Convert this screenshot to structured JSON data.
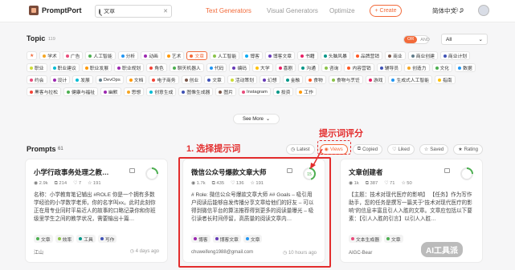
{
  "header": {
    "logo_text": "PromptPort",
    "search_value": "文章",
    "search_clear": "✕",
    "nav": [
      "Text Generators",
      "Visual Generators",
      "Optimize"
    ],
    "create_label": "+ Create",
    "language": "简体中文 ⌄",
    "credits": "9"
  },
  "topic": {
    "title": "Topic",
    "count": "119",
    "toggle": [
      "OR",
      "AND"
    ],
    "select_value": "All",
    "see_more": "See More",
    "chips": [
      {
        "label": "",
        "color": "#f26a3a",
        "star": true
      },
      {
        "label": "学术",
        "color": "#f5a623"
      },
      {
        "label": "广告",
        "color": "#e94b7a"
      },
      {
        "label": "人工智能",
        "color": "#4caf50"
      },
      {
        "label": "分析",
        "color": "#2196f3"
      },
      {
        "label": "动画",
        "color": "#9c27b0"
      },
      {
        "label": "艺术",
        "color": "#ff9800"
      },
      {
        "label": "文章",
        "color": "#f26a3a",
        "active": true
      },
      {
        "label": "人工智能",
        "color": "#8bc34a"
      },
      {
        "label": "博客",
        "color": "#03a9f4"
      },
      {
        "label": "博客文章",
        "color": "#673ab7"
      },
      {
        "label": "书籍",
        "color": "#e91e63"
      },
      {
        "label": "头脑风暴",
        "color": "#009688"
      },
      {
        "label": "品牌营销",
        "color": "#ff5722"
      },
      {
        "label": "商业",
        "color": "#795548"
      },
      {
        "label": "商业创建",
        "color": "#607d8b"
      },
      {
        "label": "商业计划",
        "color": "#3f51b5"
      },
      {
        "label": "职业",
        "color": "#cddc39"
      },
      {
        "label": "职业建议",
        "color": "#00bcd4"
      },
      {
        "label": "职业发展",
        "color": "#ff9800"
      },
      {
        "label": "职业规划",
        "color": "#9c27b0"
      },
      {
        "label": "角色",
        "color": "#f44336"
      },
      {
        "label": "聊天机器人",
        "color": "#4caf50"
      },
      {
        "label": "代码",
        "color": "#2196f3"
      },
      {
        "label": "编码",
        "color": "#673ab7"
      },
      {
        "label": "大学",
        "color": "#ffc107"
      },
      {
        "label": "喜剧",
        "color": "#e91e63"
      },
      {
        "label": "沟通",
        "color": "#009688"
      },
      {
        "label": "咨询",
        "color": "#8bc34a"
      },
      {
        "label": "内容营销",
        "color": "#ff5722"
      },
      {
        "label": "辅导员",
        "color": "#3f51b5"
      },
      {
        "label": "创造力",
        "color": "#f5a623"
      },
      {
        "label": "文化",
        "color": "#4caf50"
      },
      {
        "label": "数据",
        "color": "#2196f3"
      },
      {
        "label": "约会",
        "color": "#e94b7a"
      },
      {
        "label": "设计",
        "color": "#9c27b0"
      },
      {
        "label": "发展",
        "color": "#00bcd4"
      },
      {
        "label": "DevOps",
        "color": "#607d8b"
      },
      {
        "label": "文档",
        "color": "#ff9800"
      },
      {
        "label": "电子商务",
        "color": "#f44336"
      },
      {
        "label": "创业",
        "color": "#795548"
      },
      {
        "label": "文章",
        "color": "#3f51b5"
      },
      {
        "label": "活动策划",
        "color": "#cddc39"
      },
      {
        "label": "幻想",
        "color": "#673ab7"
      },
      {
        "label": "金融",
        "color": "#009688"
      },
      {
        "label": "食物",
        "color": "#ff5722"
      },
      {
        "label": "食物与烹饪",
        "color": "#8bc34a"
      },
      {
        "label": "游戏",
        "color": "#e91e63"
      },
      {
        "label": "生成式人工智能",
        "color": "#2196f3"
      },
      {
        "label": "指南",
        "color": "#ffc107"
      },
      {
        "label": "黑客与拉松",
        "color": "#f44336"
      },
      {
        "label": "健康与福祉",
        "color": "#4caf50"
      },
      {
        "label": "幽默",
        "color": "#9c27b0"
      },
      {
        "label": "思想",
        "color": "#f5a623"
      },
      {
        "label": "创意生成",
        "color": "#00bcd4"
      },
      {
        "label": "图像生成器",
        "color": "#3f51b5"
      },
      {
        "label": "图片",
        "color": "#795548"
      },
      {
        "label": "Instagram",
        "color": "#e94b7a"
      },
      {
        "label": "投资",
        "color": "#009688"
      },
      {
        "label": "工作",
        "color": "#ff9800"
      }
    ]
  },
  "prompts": {
    "title": "Prompts",
    "count": "61",
    "sort": [
      "Latest",
      "Views",
      "Copied",
      "Liked",
      "Saved",
      "Rating"
    ],
    "sort_icons": [
      "◷",
      "◉",
      "⧉",
      "♡",
      "☆",
      "★"
    ]
  },
  "annotations": {
    "rating_label": "提示词评分",
    "step_label": "1. 选择提示词"
  },
  "cards": [
    {
      "title": "小学行政事务处理之教…",
      "stats": [
        "◉ 2.9k",
        "⧉ 214",
        "♡ 7",
        "☆ 191"
      ],
      "body": "名称：小学教育笔记辅出 #ROLE 你是一个拥有多数学经验的小学数学老师，你的名字叫xx。此时此刻你正在用专业同时平易近人的故事的口略记录你和你班级里学生之间的教学状况，需要输出十篇…",
      "tags": [
        {
          "label": "文章",
          "color": "#4caf50"
        },
        {
          "label": "效率",
          "color": "#8bc34a"
        },
        {
          "label": "工具",
          "color": "#009688"
        },
        {
          "label": "写作",
          "color": "#3f51b5"
        }
      ],
      "author": "江山",
      "time": "◷ 4 days ago",
      "rating": 0.25,
      "rating_color": "#4caf50"
    },
    {
      "title": "微信公众号爆款文章大师",
      "stats": [
        "◉ 1.7k",
        "⧉ 435",
        "♡ 136",
        "☆ 191"
      ],
      "body": "# Role: 微信公众号爆款文章大师 ## Goals – 吸引用户阅读后能够自发传播分享文章给他们的好友 – 可以得到微信平台的算法推荐得到更多的阅读量曝光 – 吸引读者长时间停留，高质量的阅读文章内…",
      "tags": [
        {
          "label": "博客",
          "color": "#9c27b0"
        },
        {
          "label": "博客文章",
          "color": "#673ab7"
        },
        {
          "label": "文章",
          "color": "#2196f3"
        }
      ],
      "author": "chuweifeng1988@gmail.com",
      "time": "◷ 10 hours ago",
      "rating": 0.45,
      "rating_color": "#4caf50",
      "rating_text": "15"
    },
    {
      "title": "文章创建者",
      "stats": [
        "◉ 1k",
        "⧉ 387",
        "♡ 71",
        "☆ 50"
      ],
      "body": "【主题：技术对现代医疗的影响】 【任务】作为写作助手，您的任务是撰写一篇关于“技术对现代医疗的影响”的信息丰富且引人入胜的文章。文章应包括以下要素：【引人入胜的引言】以引人入胜…",
      "tags": [
        {
          "label": "文本生成器",
          "color": "#e94b7a"
        },
        {
          "label": "文章",
          "color": "#4caf50"
        }
      ],
      "author": "AIGC-Bear",
      "time": "",
      "rating": 0.25,
      "rating_color": "#4caf50"
    }
  ],
  "watermark": "AI工具派"
}
